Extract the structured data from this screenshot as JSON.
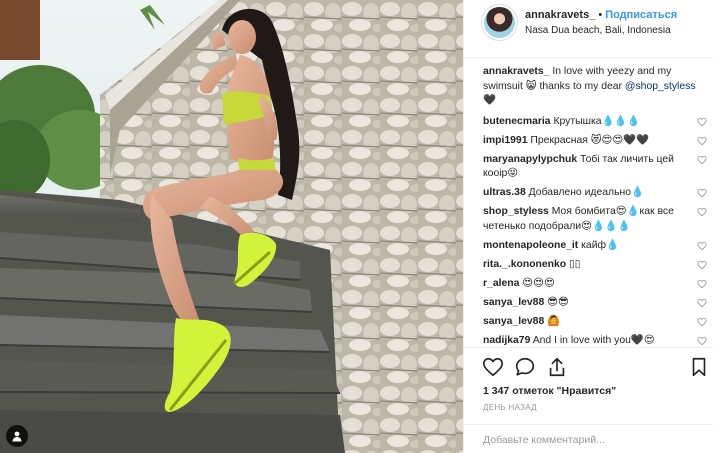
{
  "header": {
    "username": "annakravets_",
    "dot": "•",
    "follow_label": "Подписаться",
    "location": "Nasa Dua beach, Bali, Indonesia"
  },
  "caption": {
    "username": "annakravets_",
    "text": "In love with yeezy and my swimsuit 😸 thanks to my dear",
    "mention": "@shop_styless",
    "tail": "🖤"
  },
  "comments": [
    {
      "username": "butenecmaria",
      "text": "Крутышка💧💧💧"
    },
    {
      "username": "impi1991",
      "text": "Прекрасная 😻😍😍🖤🖤"
    },
    {
      "username": "maryanapylypchuk",
      "text": "Тобі так личить цей кооір😝"
    },
    {
      "username": "ultras.38",
      "text": "Добавлено идеально💧"
    },
    {
      "username": "shop_styless",
      "text": "Моя бомбита😍💧как все четенько подобрали😍💧💧💧"
    },
    {
      "username": "montenapoleone_it",
      "text": "кайф💧"
    },
    {
      "username": "rita._.kononenko",
      "text": "▯▯"
    },
    {
      "username": "r_alena",
      "text": "😍😍😍"
    },
    {
      "username": "sanya_lev88",
      "text": "😎😎"
    },
    {
      "username": "sanya_lev88",
      "text": "🙆"
    },
    {
      "username": "nadijka79",
      "text": "And I in love with you🖤😍"
    }
  ],
  "likes": "1 347 отметок \"Нравится\"",
  "time": "ДЕНЬ НАЗАД",
  "add_comment": {
    "placeholder": "Добавьте комментарий..."
  },
  "icons": [
    "like-heart-icon",
    "comment-icon",
    "share-icon",
    "bookmark-icon",
    "user-tag-icon"
  ],
  "colors": {
    "link": "#003569",
    "follow": "#3897f0",
    "text": "#262626",
    "muted": "#999999"
  }
}
